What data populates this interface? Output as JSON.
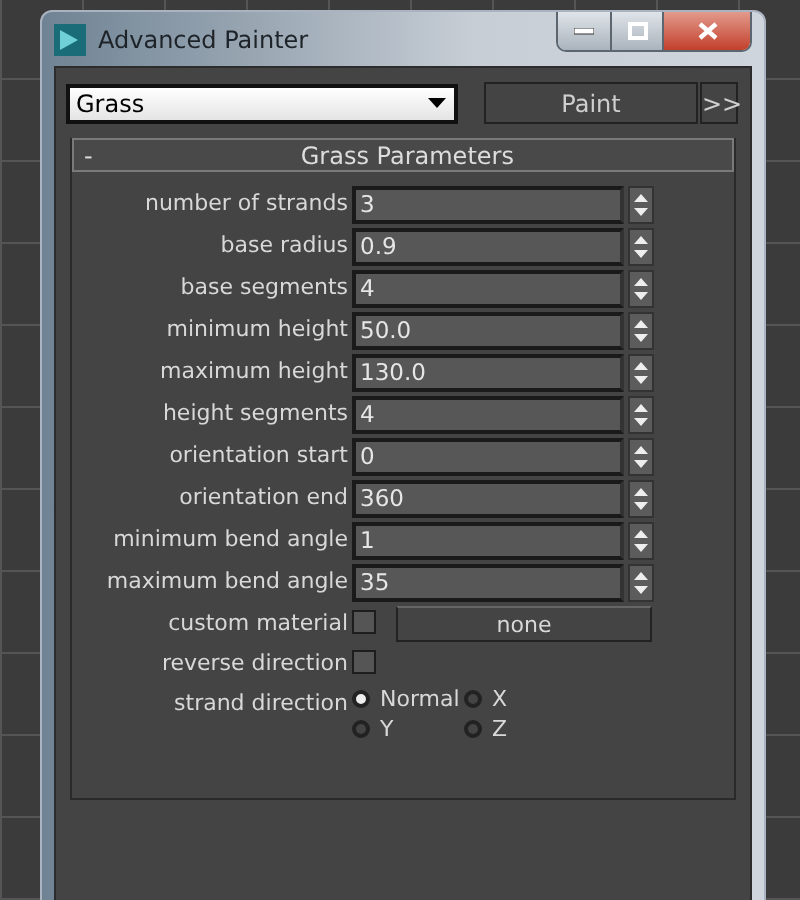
{
  "window": {
    "title": "Advanced Painter"
  },
  "preset": {
    "value": "Grass"
  },
  "paint_button": "Paint",
  "expand_button": ">>",
  "rollout": {
    "collapse": "-",
    "title": "Grass Parameters",
    "params": [
      {
        "kind": "spinner",
        "label": "number of strands",
        "value": "3"
      },
      {
        "kind": "spinner",
        "label": "base radius",
        "value": "0.9"
      },
      {
        "kind": "spinner",
        "label": "base segments",
        "value": "4"
      },
      {
        "kind": "spinner",
        "label": "minimum height",
        "value": "50.0"
      },
      {
        "kind": "spinner",
        "label": "maximum height",
        "value": "130.0"
      },
      {
        "kind": "spinner",
        "label": "height segments",
        "value": "4"
      },
      {
        "kind": "spinner",
        "label": "orientation start",
        "value": "0"
      },
      {
        "kind": "spinner",
        "label": "orientation end",
        "value": "360"
      },
      {
        "kind": "spinner",
        "label": "minimum bend angle",
        "value": "1"
      },
      {
        "kind": "spinner",
        "label": "maximum bend angle",
        "value": "35"
      },
      {
        "kind": "checkbox",
        "label": "custom material",
        "checked": false,
        "button": "none"
      },
      {
        "kind": "checkbox",
        "label": "reverse direction",
        "checked": false
      },
      {
        "kind": "radio",
        "label": "strand direction",
        "options": [
          {
            "label": "Normal",
            "selected": true
          },
          {
            "label": "X",
            "selected": false
          },
          {
            "label": "Y",
            "selected": false
          },
          {
            "label": "Z",
            "selected": false
          }
        ]
      }
    ]
  }
}
